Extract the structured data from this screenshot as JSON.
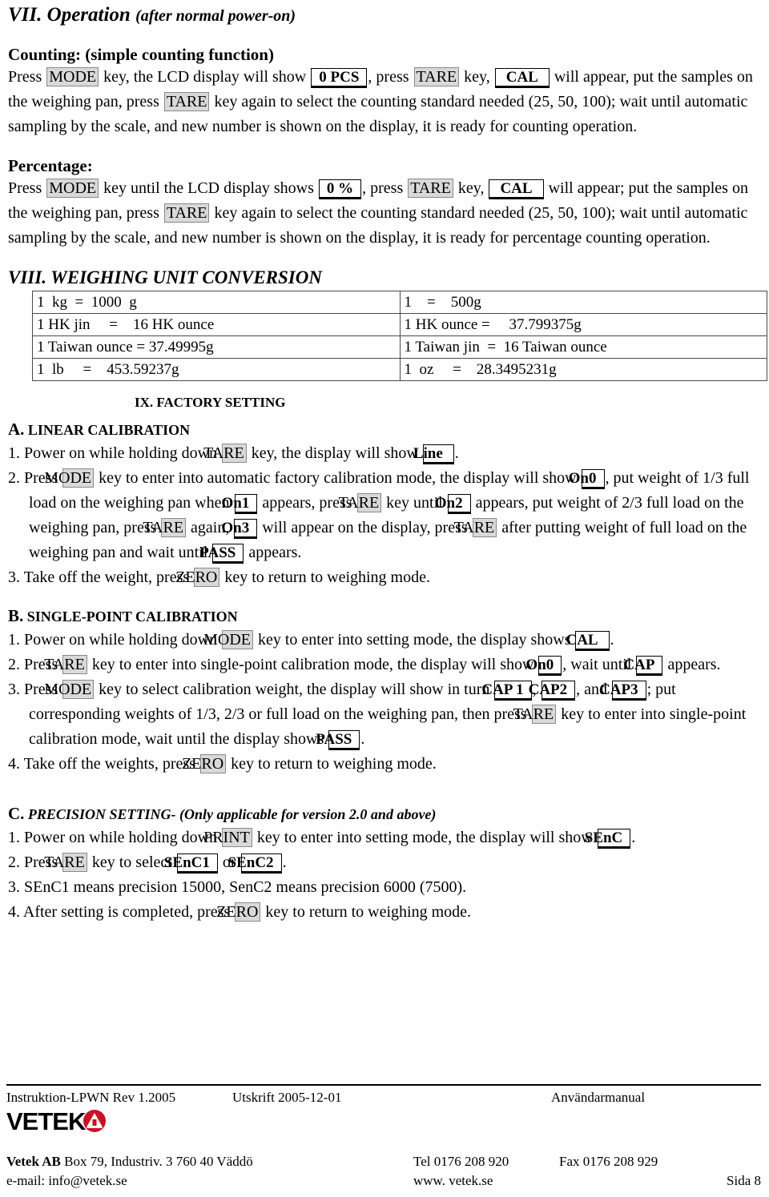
{
  "sections": {
    "operation": {
      "number": "VII.",
      "title": "Operation",
      "subtitle": "(after normal power-on)",
      "counting": {
        "heading": "Counting: (simple counting function)",
        "t1": "Press ",
        "key_mode": "MODE",
        "t2": " key, the LCD display will show ",
        "lcd_pcs": "0 PCS",
        "t3": ", press ",
        "key_tare1": "TARE",
        "t4": " key, ",
        "lcd_cal": "CAL",
        "t5": " will appear, put the samples on the weighing pan, press ",
        "key_tare2": "TARE",
        "t6": " key again to select the counting standard needed (25, 50, 100); wait until automatic sampling by the scale, and new number is shown on the display, it is ready for counting operation."
      },
      "percentage": {
        "heading": "Percentage:",
        "t1": "Press ",
        "key_mode": "MODE",
        "t2": " key until the LCD display shows ",
        "lcd_pct": "0  %",
        "t3": ", press ",
        "key_tare1": "TARE",
        "t4": " key, ",
        "lcd_cal": "CAL",
        "t5": " will appear; put the samples on the weighing pan, press ",
        "key_tare2": "TARE",
        "t6": " key again to select the counting standard needed (25, 50, 100); wait until automatic sampling by the scale, and new number is shown on the display, it is ready for percentage counting operation."
      }
    },
    "conversion": {
      "number": "VIII.",
      "title": "WEIGHING UNIT CONVERSION",
      "rows": [
        [
          "1  kg  =  1000  g",
          "1    =    500g"
        ],
        [
          "1 HK jin     =    16 HK ounce",
          "1 HK ounce =     37.799375g"
        ],
        [
          "1 Taiwan ounce = 37.49995g",
          "1 Taiwan jin  =  16 Taiwan ounce"
        ],
        [
          "1  lb     =    453.59237g",
          "1  oz     =    28.3495231g"
        ]
      ]
    },
    "factory": {
      "heading": "IX. FACTORY SETTING",
      "linear": {
        "heading_lead": "A.",
        "heading_rest": " LINEAR CALIBRATION",
        "step1": {
          "t1": "1. Power on while holding down ",
          "key_tare": "TARE",
          "t2": " key, the display will show ",
          "lcd_line": "Line",
          "t3": "."
        },
        "step2": {
          "t1": "2. Press ",
          "key_mode": "MODE",
          "t2": " key to enter into automatic factory calibration mode, the display will show ",
          "lcd_on0": "On0",
          "t3": ", put weight of 1/3 full load on the weighing pan when ",
          "lcd_on1": "On1",
          "t4": " appears, press ",
          "key_tare1": "TARE",
          "t5": " key until ",
          "lcd_on2": "On2",
          "t6": " appears, put weight of 2/3 full load on the weighing pan, press ",
          "key_tare2": "TARE",
          "t7": " again, ",
          "lcd_on3": "On3",
          "t8": " will appear on the display, press ",
          "key_tare3": "TARE",
          "t9": " after putting weight of full load on the weighing pan and wait until ",
          "lcd_pass": "PASS",
          "t10": " appears."
        },
        "step3": {
          "t1": "3. Take off the weight, press ",
          "key_zero": "ZERO",
          "t2": " key to return to weighing mode."
        }
      },
      "single": {
        "heading_lead": "B.",
        "heading_rest": " SINGLE-POINT CALIBRATION",
        "step1": {
          "t1": "1. Power on while holding down ",
          "key_mode": "MODE",
          "t2": " key to enter into setting mode, the display shows ",
          "lcd_cal": "CAL",
          "t3": "."
        },
        "step2": {
          "t1": "2. Press ",
          "key_tare": "TARE",
          "t2": " key to enter into single-point calibration mode, the display will show ",
          "lcd_on0": "On0",
          "t3": ", wait until ",
          "lcd_cap": "CAP",
          "t4": " appears."
        },
        "step3": {
          "t1": "3. Press ",
          "key_mode": "MODE",
          "t2": " key to select calibration weight, the display will show in turn ",
          "lcd_cap1": "CAP 1",
          "t3": ", ",
          "lcd_cap2": "CAP2",
          "t4": ", and ",
          "lcd_cap3": "CAP3",
          "t5": "; put corresponding weights of 1/3, 2/3 or full load on the weighing pan, then press ",
          "key_tare": "TARE",
          "t6": " key to enter into single-point calibration mode, wait until the display shows ",
          "lcd_pass": "PASS",
          "t7": "."
        },
        "step4": {
          "t1": "4. Take off the weights, press ",
          "key_zero": "ZERO",
          "t2": " key to return to weighing mode."
        }
      },
      "precision": {
        "heading_lead": "C.",
        "heading_rest": " PRECISION SETTING- (Only applicable for version 2.0 and above)",
        "step1": {
          "t1": "1. Power on while holding down ",
          "key_print": "PRINT",
          "t2": " key to enter into setting mode, the display will show ",
          "lcd_senc": "SEnC",
          "t3": "."
        },
        "step2": {
          "t1": "2. Press ",
          "key_tare": "TARE",
          "t2": " key to select ",
          "lcd_senc1": "SEnC1",
          "t3": " or ",
          "lcd_senc2": "SEnC2",
          "t4": "."
        },
        "step3": {
          "t1": "3. SEnC1 means precision 15000, SenC2 means precision 6000 (7500)."
        },
        "step4": {
          "t1": "4. After setting is completed, press ",
          "key_zero": "ZERO",
          "t2": " key to return to weighing mode."
        }
      }
    }
  },
  "footer": {
    "doc_ref": "Instruktion-LPWN Rev 1.2005",
    "print_date": "Utskrift 2005-12-01",
    "doc_type": "Användarmanual",
    "logo_text": "VETEK",
    "company_bold": "Vetek AB",
    "company_rest": " Box 79, Industriv. 3  760 40 Väddö",
    "tel": "Tel  0176 208 920",
    "fax": "Fax 0176 208 929",
    "email": "e-mail: info@vetek.se",
    "web": "www. vetek.se",
    "page": "Sida  8"
  },
  "colors": {
    "key_bg": "#d9d9d9",
    "logo_red": "#cc1122",
    "text": "#000000"
  }
}
